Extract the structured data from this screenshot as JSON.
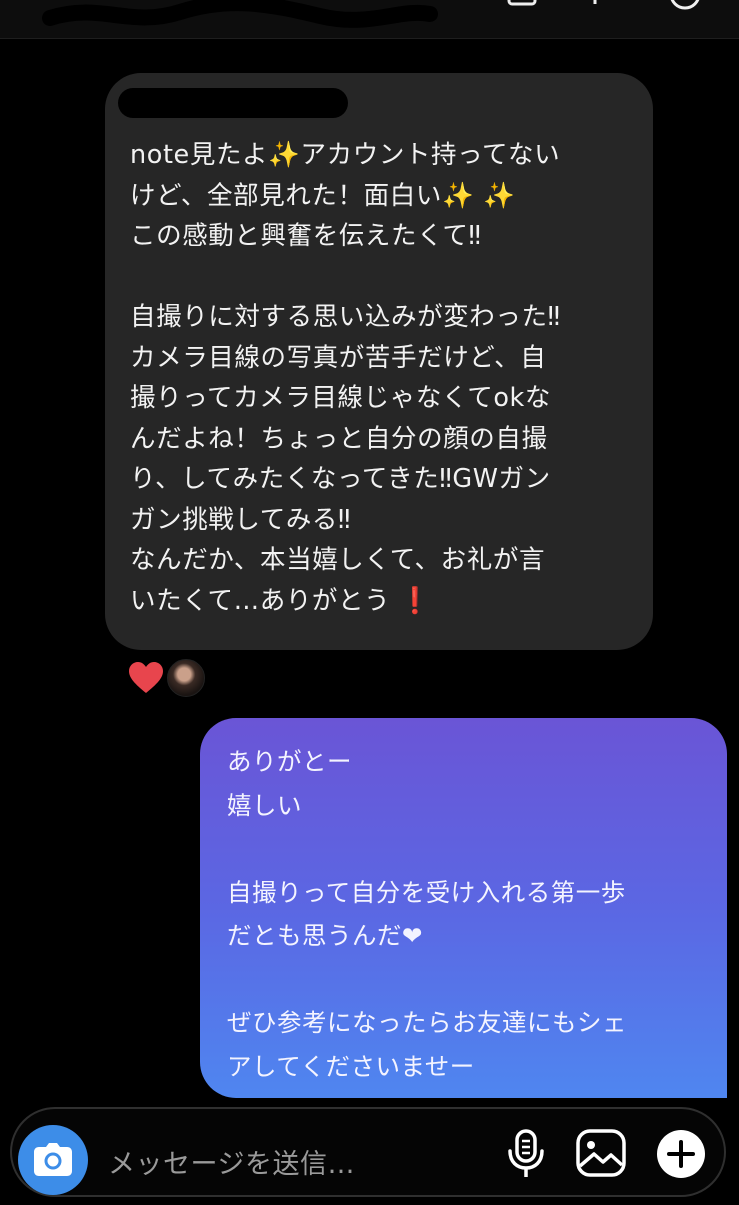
{
  "incoming_message": {
    "lines": [
      "note見たよ",
      "✨",
      "アカウント持ってない",
      "けど、全部見れた！面白い",
      "✨ ✨",
      "この感動と興奮を伝えたくて‼︎",
      "自撮りに対する思い込みが変わった‼︎",
      "カメラ目線の写真が苦手だけど、自",
      "撮りってカメラ目線じゃなくてokな",
      "んだよね！ちょっと自分の顔の自撮",
      "り、してみたくなってきた‼︎GWガン",
      "ガン挑戦してみる‼︎",
      "なんだか、本当嬉しくて、お礼が言",
      "いたくて…ありがとう",
      "❗️"
    ],
    "reaction_icon": "heart-icon",
    "reaction_color": "#e8454d"
  },
  "outgoing_message": {
    "lines": [
      "ありがとー",
      "嬉しい",
      "自撮りって自分を受け入れる第一歩",
      "だとも思うんだ",
      "❤",
      "ぜひ参考になったらお友達にもシェ",
      "アしてくださいませー"
    ]
  },
  "composer": {
    "placeholder": "メッセージを送信…",
    "camera_icon": "camera-icon",
    "mic_icon": "microphone-icon",
    "gallery_icon": "image-icon",
    "add_icon": "plus-icon"
  },
  "colors": {
    "background": "#000000",
    "incoming_bubble": "#262626",
    "outgoing_gradient_top": "#6a55d6",
    "outgoing_gradient_bottom": "#4f86f0",
    "camera_button": "#3d8de8"
  }
}
